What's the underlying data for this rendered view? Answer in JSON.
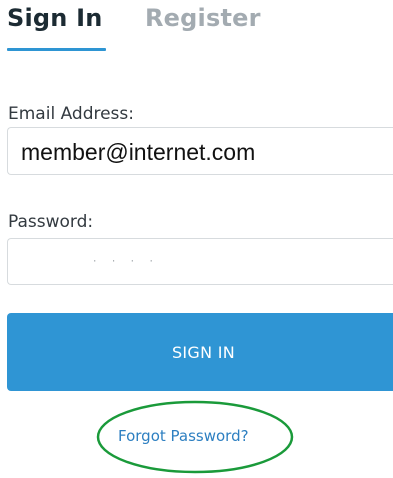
{
  "tabs": {
    "signin_label": "Sign In",
    "register_label": "Register",
    "active": "Sign In"
  },
  "form": {
    "email_label": "Email Address:",
    "email_value": "member@internet.com",
    "password_label": "Password:",
    "password_mask": "· · · ·",
    "submit_label": "SIGN IN",
    "forgot_label": "Forgot Password?"
  },
  "colors": {
    "accent": "#2f95d4",
    "link": "#2d7fc1",
    "highlight_ellipse": "#1a9a3a"
  },
  "icons": {
    "highlight": "annotation-ellipse"
  }
}
